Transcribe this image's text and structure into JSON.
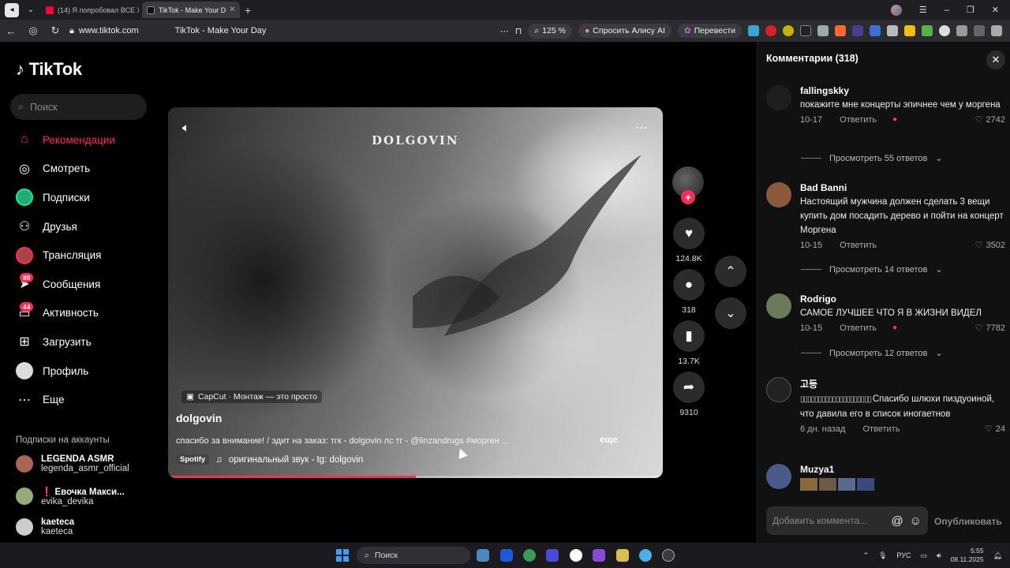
{
  "browser": {
    "tabs": [
      {
        "label": "(14) Я попробовал ВСЕ Ж",
        "active": false,
        "favicon_color": "#ff0033"
      },
      {
        "label": "TikTok - Make Your D",
        "active": true,
        "favicon_color": "#111111"
      }
    ],
    "address": {
      "url": "www.tiktok.com",
      "page_title": "TikTok - Make Your Day",
      "zoom": "125 %",
      "alice_button": "Спросить Алису AI",
      "translate_button": "Перевести"
    }
  },
  "sidebar": {
    "logo": "TikTok",
    "search_placeholder": "Поиск",
    "items": [
      {
        "label": "Рекомендации",
        "icon": "home-icon",
        "active": true
      },
      {
        "label": "Смотреть",
        "icon": "compass-icon"
      },
      {
        "label": "Подписки",
        "icon": "following-avatar-icon"
      },
      {
        "label": "Друзья",
        "icon": "friends-icon"
      },
      {
        "label": "Трансляция",
        "icon": "live-avatar-icon"
      },
      {
        "label": "Сообщения",
        "icon": "messages-icon",
        "badge": "89"
      },
      {
        "label": "Активность",
        "icon": "activity-icon",
        "badge": "44"
      },
      {
        "label": "Загрузить",
        "icon": "upload-icon"
      },
      {
        "label": "Профиль",
        "icon": "profile-icon"
      },
      {
        "label": "Еще",
        "icon": "more-icon"
      }
    ],
    "subs_title": "Подписки на аккаунты",
    "subs": [
      {
        "name": "LEGENDA ASMR",
        "handle": "legenda_asmr_official"
      },
      {
        "name": "❗ Евочка Макси...",
        "handle": "evika_devika"
      },
      {
        "name": "kaeteca",
        "handle": "kaeteca"
      }
    ]
  },
  "video": {
    "watermark": "DOLGOVIN",
    "capcut": "CapCut · Монтаж — это просто",
    "author": "dolgovin",
    "description": "спасибо за внимание!   /   эдит на заказ: тгк - dolgovin лс тг - @linzandrugs #морген ...",
    "more_label": "еще",
    "spotify_label": "Spotify",
    "music": "оригинальный звук - tg: dolgovin",
    "progress": 0.5
  },
  "actions": {
    "likes": "124.8K",
    "comments": "318",
    "saves": "13.7K",
    "shares": "9310"
  },
  "comments_panel": {
    "title": "Комментарии (318)",
    "reply_label": "Ответить",
    "input_placeholder": "Добавить коммента...",
    "post_label": "Опубликовать",
    "comments": [
      {
        "user": "fallingskky",
        "text": "покажите мне концерты эпичнее чем у моргена",
        "date": "10-17",
        "likes": "2742",
        "replies": "Просмотреть 55 ответов"
      },
      {
        "user": "Bad Banni",
        "text": "Настоящий мужчина должен сделать 3 вещи купить дом посадить дерево и пойти на концерт Моргена",
        "date": "10-15",
        "likes": "3502",
        "replies": "Просмотреть 14 ответов"
      },
      {
        "user": "Rodrigo",
        "text": "САМОЕ ЛУЧШЕЕ ЧТО Я В ЖИЗНИ ВИДЕЛ",
        "date": "10-15",
        "likes": "7782",
        "replies": "Просмотреть 12 ответов"
      },
      {
        "user": "고등",
        "text": "Спасибо шлюхи пиздуоиной, что давила его в список иногаетнов",
        "date": "6 дн. назад",
        "likes": "24"
      },
      {
        "user": "Muzya1",
        "text": ""
      }
    ]
  },
  "taskbar": {
    "search_placeholder": "Поиск",
    "lang": "РУС",
    "time": "5:55",
    "date": "08.11.2025"
  }
}
